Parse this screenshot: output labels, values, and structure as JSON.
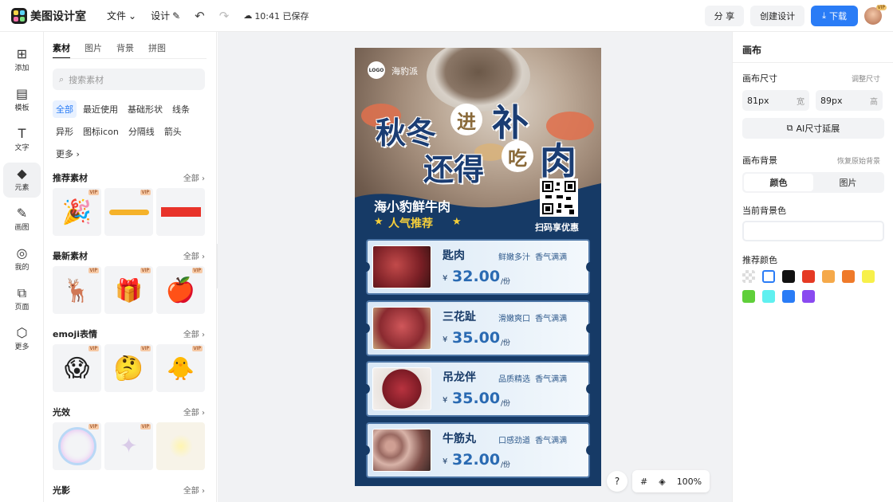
{
  "app": {
    "name": "美图设计室"
  },
  "topbar": {
    "file_menu": "文件",
    "design_menu": "设计",
    "saved_status": "10:41 已保存",
    "share": "分 享",
    "create_design": "创建设计",
    "download": "下载",
    "avatar_badge": "VIP"
  },
  "rail": [
    {
      "label": "添加",
      "icon": "plus-square-icon"
    },
    {
      "label": "模板",
      "icon": "template-icon"
    },
    {
      "label": "文字",
      "icon": "text-icon"
    },
    {
      "label": "元素",
      "icon": "shapes-icon"
    },
    {
      "label": "画图",
      "icon": "draw-icon"
    },
    {
      "label": "我的",
      "icon": "user-icon"
    },
    {
      "label": "页面",
      "icon": "page-icon"
    },
    {
      "label": "更多",
      "icon": "cube-icon"
    }
  ],
  "left_panel": {
    "tabs": [
      "素材",
      "图片",
      "背景",
      "拼图"
    ],
    "search_placeholder": "搜索素材",
    "chips": [
      "全部",
      "最近使用",
      "基础形状",
      "线条",
      "异形",
      "图标icon",
      "分隔线",
      "箭头",
      "更多 ›"
    ],
    "sections": [
      {
        "title": "推荐素材",
        "all": "全部 ›"
      },
      {
        "title": "最新素材",
        "all": "全部 ›"
      },
      {
        "title": "emoji表情",
        "all": "全部 ›"
      },
      {
        "title": "光效",
        "all": "全部 ›"
      },
      {
        "title": "光影",
        "all": "全部 ›"
      }
    ],
    "vip": "VIP"
  },
  "poster": {
    "logo": "LOGO",
    "brand": "海豹派",
    "headline_line1_a": "秋冬",
    "headline_circle1": "进",
    "headline_line1_b": "补",
    "headline_line2_a": "还得",
    "headline_circle2": "吃",
    "headline_line2_b": "肉",
    "subtitle": "海小豹鲜牛肉",
    "subtitle2": "人气推荐",
    "qr_caption": "扫码享优惠",
    "items": [
      {
        "name": "匙肉",
        "desc": "鲜嫩多汁 香气满满",
        "yen": "¥",
        "price": "32.00",
        "unit": "/份"
      },
      {
        "name": "三花趾",
        "desc": "滑嫩爽口 香气满满",
        "yen": "¥",
        "price": "35.00",
        "unit": "/份"
      },
      {
        "name": "吊龙伴",
        "desc": "品质精选 香气满满",
        "yen": "¥",
        "price": "35.00",
        "unit": "/份"
      },
      {
        "name": "牛筋丸",
        "desc": "口感劲道 香气满满",
        "yen": "¥",
        "price": "32.00",
        "unit": "/份"
      }
    ]
  },
  "bottom_tools": {
    "help": "?",
    "zoom": "100%"
  },
  "right_panel": {
    "title": "画布",
    "size_label": "画布尺寸",
    "adjust_size": "调整尺寸",
    "width_value": "81px",
    "width_unit": "宽",
    "height_value": "89px",
    "height_unit": "高",
    "ai_extend": "AI尺寸延展",
    "bg_label": "画布背景",
    "restore_bg": "恢复原始背景",
    "seg_color": "颜色",
    "seg_image": "图片",
    "current_bg": "当前背景色",
    "recommend": "推荐颜色",
    "swatches": [
      "transparent",
      "#ffffff",
      "#111111",
      "#e53a24",
      "#f5a94a",
      "#ef7a2a",
      "#f7f04a",
      "#5fcf3a",
      "#5ff0f0",
      "#2a7cf6",
      "#8a4af0"
    ]
  }
}
